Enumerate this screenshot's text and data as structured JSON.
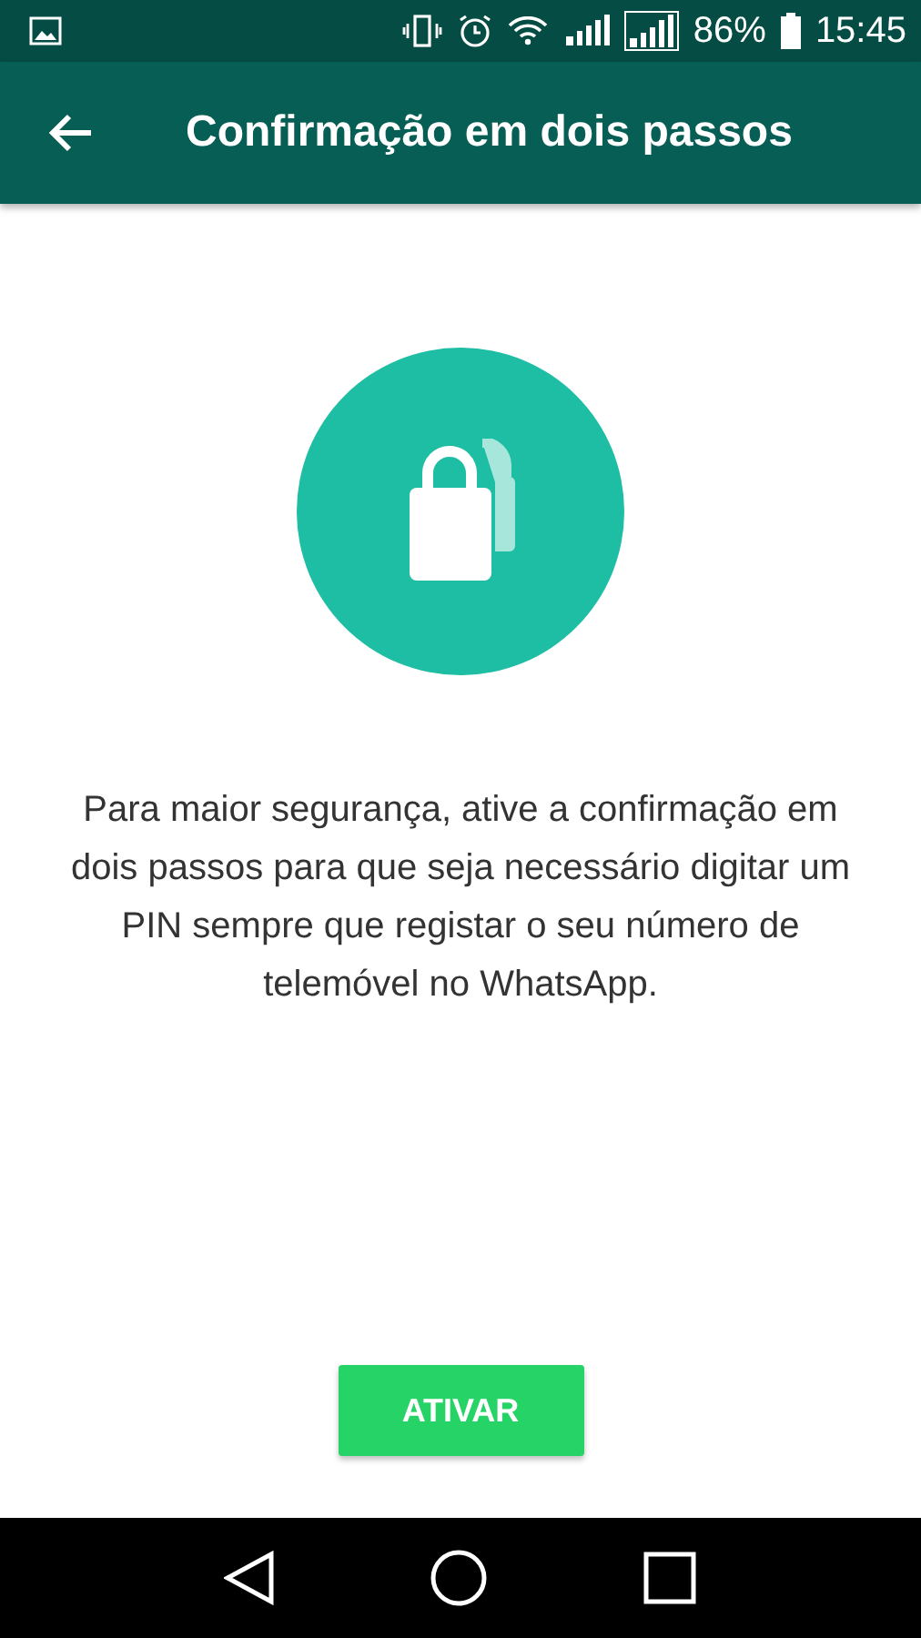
{
  "status_bar": {
    "battery": "86%",
    "time": "15:45"
  },
  "app_bar": {
    "title": "Confirmação em dois passos"
  },
  "description": "Para maior segurança, ative a confirmação em dois passos para que seja necessário digitar um PIN sempre que registar o seu número de telemóvel no WhatsApp.",
  "button": "ATIVAR"
}
